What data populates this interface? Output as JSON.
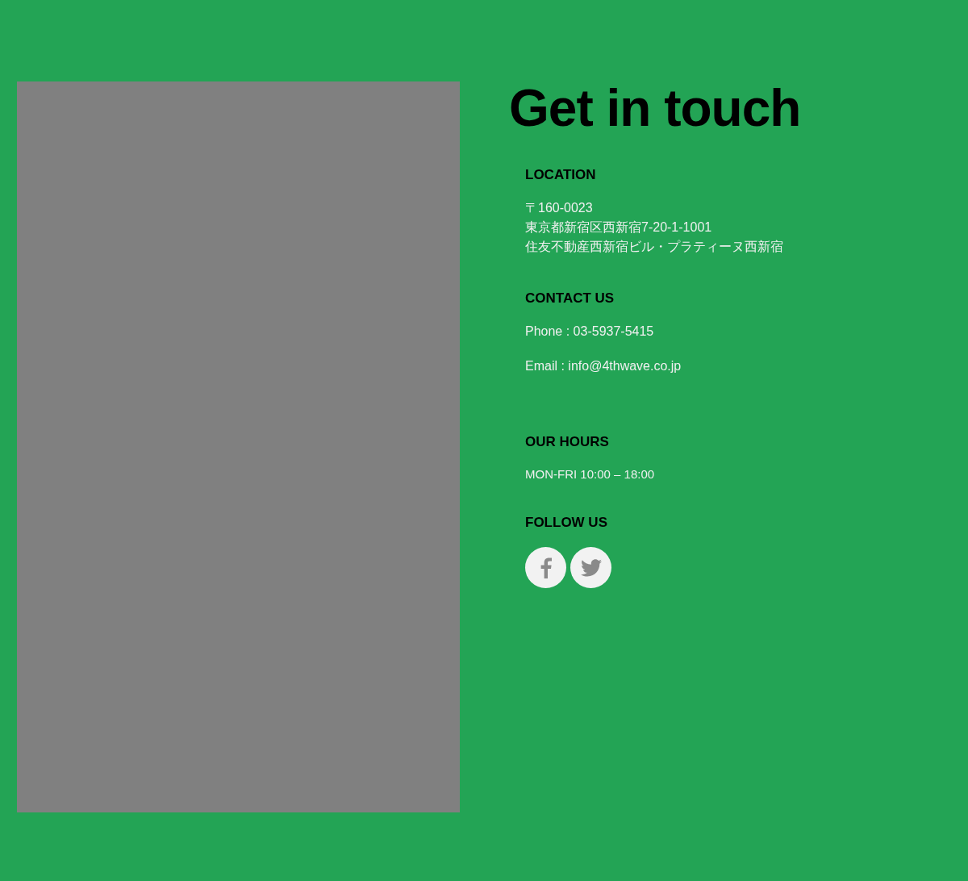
{
  "title": "Get in touch",
  "sections": [
    {
      "kind": "address",
      "heading": "LOCATION",
      "lines": [
        "〒160-0023",
        "東京都新宿区西新宿7-20-1-1001",
        "住友不動産西新宿ビル・プラティーヌ西新宿"
      ]
    },
    {
      "kind": "contact",
      "heading": "CONTACT US",
      "lines": [
        "Phone : 03-5937-5415",
        "Email : info@4thwave.co.jp"
      ]
    },
    {
      "kind": "hours",
      "heading": "OUR HOURS",
      "lines": [
        "MON-FRI 10:00 – 18:00"
      ]
    },
    {
      "kind": "social",
      "heading": "FOLLOW US",
      "links": [
        {
          "kind": "facebook"
        },
        {
          "kind": "twitter"
        }
      ]
    }
  ]
}
